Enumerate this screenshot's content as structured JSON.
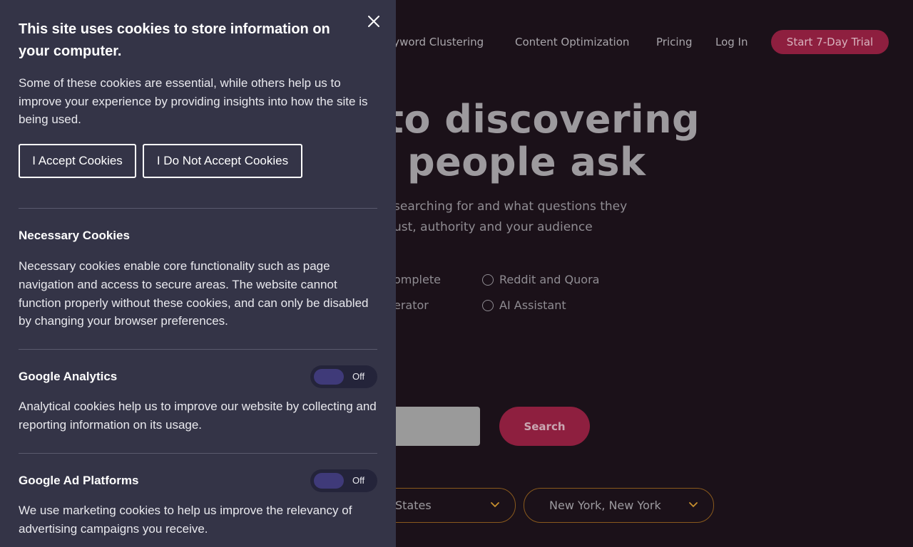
{
  "background": {
    "nav": {
      "items": [
        "eyword Clustering",
        "Content Optimization",
        "Pricing",
        "Log In"
      ],
      "cta": "Start 7-Day Trial"
    },
    "hero": {
      "line1": "to discovering",
      "line2": "people ask"
    },
    "subtitle": {
      "line1": "searching for and what questions they",
      "line2": "ust, authority and your audience"
    },
    "options": [
      "omplete",
      "erator",
      "Reddit and Quora",
      "AI Assistant"
    ],
    "search": {
      "button": "Search"
    },
    "selects": {
      "country": "States",
      "city": "New York, New York"
    }
  },
  "cookie_panel": {
    "title": "This site uses cookies to store information on your computer.",
    "intro": "Some of these cookies are essential, while others help us to improve your experience by providing insights into how the site is being used.",
    "accept_label": "I Accept Cookies",
    "decline_label": "I Do Not Accept Cookies",
    "sections": [
      {
        "title": "Necessary Cookies",
        "text": "Necessary cookies enable core functionality such as page navigation and access to secure areas. The website cannot function properly without these cookies, and can only be disabled by changing your browser preferences."
      },
      {
        "title": "Google Analytics",
        "text": "Analytical cookies help us to improve our website by collecting and reporting information on its usage.",
        "toggle": "Off"
      },
      {
        "title": "Google Ad Platforms",
        "text": "We use marketing cookies to help us improve the relevancy of advertising campaigns you receive.",
        "toggle": "Off"
      }
    ]
  }
}
